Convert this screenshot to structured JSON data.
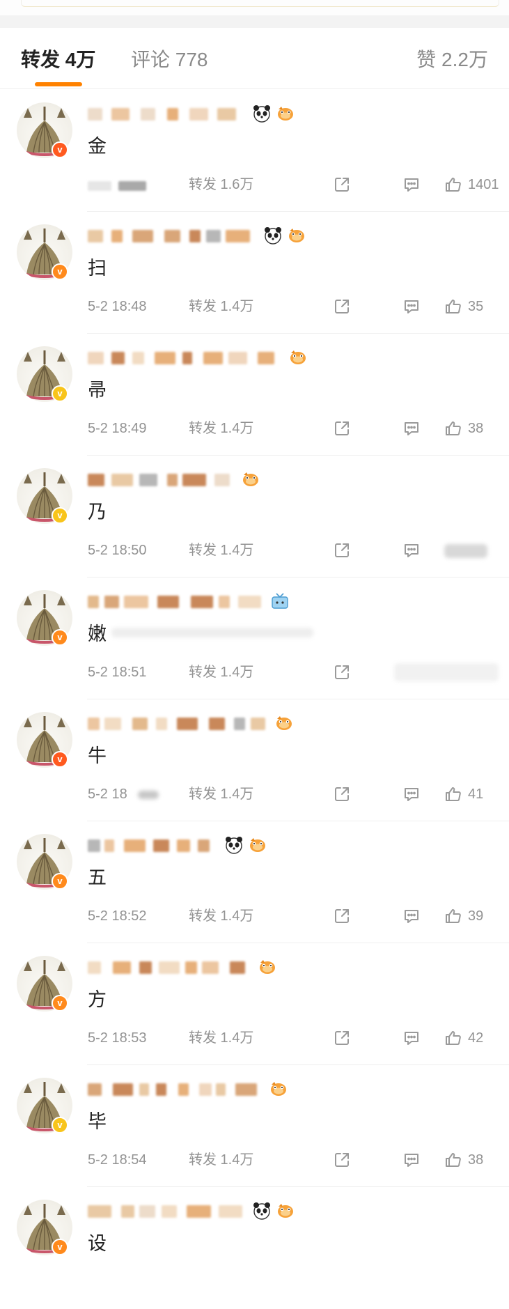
{
  "tabs": {
    "repost_label": "转发 4万",
    "comment_label": "评论 778",
    "like_label": "赞 2.2万"
  },
  "colors": {
    "accent": "#ff8200",
    "badge_red": "#ff5a1f",
    "badge_orange": "#ff8a1c",
    "badge_yellow": "#f8c41b",
    "meta_gray": "#939393"
  },
  "reposts": [
    {
      "content": "金",
      "time": "",
      "reposts": "转发 1.6万",
      "likes": "1401",
      "badge": "red",
      "emojis": [
        "panda-emoji",
        "fish-emoji"
      ]
    },
    {
      "content": "扫",
      "time": "5-2 18:48",
      "reposts": "转发 1.4万",
      "likes": "35",
      "badge": "orange",
      "emojis": [
        "panda-emoji",
        "fish-emoji"
      ]
    },
    {
      "content": "帚",
      "time": "5-2 18:49",
      "reposts": "转发 1.4万",
      "likes": "38",
      "badge": "yellow",
      "emojis": [
        "fish-emoji"
      ]
    },
    {
      "content": "乃",
      "time": "5-2 18:50",
      "reposts": "转发 1.4万",
      "likes": "",
      "badge": "yellow",
      "emojis": [
        "fish-emoji"
      ]
    },
    {
      "content": "嫩",
      "time": "5-2 18:51",
      "reposts": "转发 1.4万",
      "likes": "",
      "badge": "orange",
      "emojis": [
        "tv-emoji"
      ]
    },
    {
      "content": "牛",
      "time": "5-2 18",
      "reposts": "转发 1.4万",
      "likes": "41",
      "badge": "red",
      "emojis": [
        "fish-emoji"
      ]
    },
    {
      "content": "五",
      "time": "5-2 18:52",
      "reposts": "转发 1.4万",
      "likes": "39",
      "badge": "orange",
      "emojis": [
        "panda-emoji",
        "fish-emoji"
      ]
    },
    {
      "content": "方",
      "time": "5-2 18:53",
      "reposts": "转发 1.4万",
      "likes": "42",
      "badge": "orange",
      "emojis": [
        "fish-emoji"
      ]
    },
    {
      "content": "毕",
      "time": "5-2 18:54",
      "reposts": "转发 1.4万",
      "likes": "38",
      "badge": "yellow",
      "emojis": [
        "fish-emoji"
      ]
    },
    {
      "content": "设",
      "time": "",
      "reposts": "",
      "likes": "",
      "badge": "orange",
      "emojis": [
        "panda-emoji",
        "fish-emoji"
      ]
    }
  ]
}
